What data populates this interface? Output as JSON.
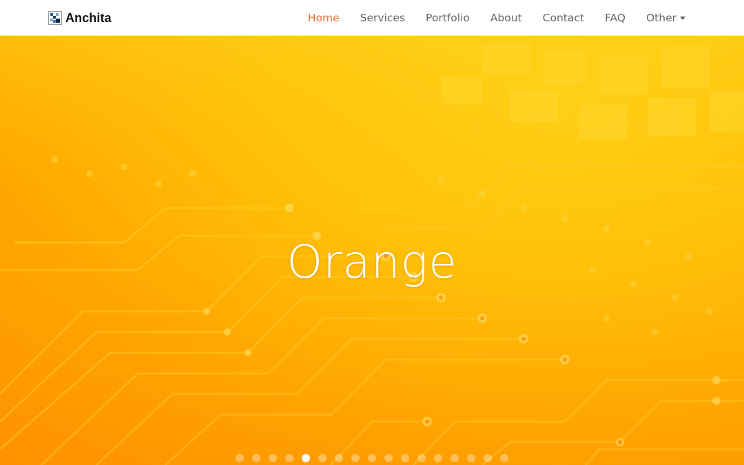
{
  "brand": {
    "name": "Anchita",
    "icon": "anchita-logo-icon"
  },
  "nav": {
    "items": [
      {
        "label": "Home",
        "active": true
      },
      {
        "label": "Services"
      },
      {
        "label": "Portfolio"
      },
      {
        "label": "About"
      },
      {
        "label": "Contact"
      },
      {
        "label": "FAQ"
      },
      {
        "label": "Other",
        "dropdown": true
      }
    ]
  },
  "carousel": {
    "title": "Orange",
    "background_theme": "orange-circuit-board",
    "slide_count": 17,
    "active_index": 4
  },
  "colors": {
    "active_nav": "#e17137",
    "nav_text": "#666666",
    "hero_orange": "#ffa400",
    "hero_yellow": "#ffd21a"
  }
}
